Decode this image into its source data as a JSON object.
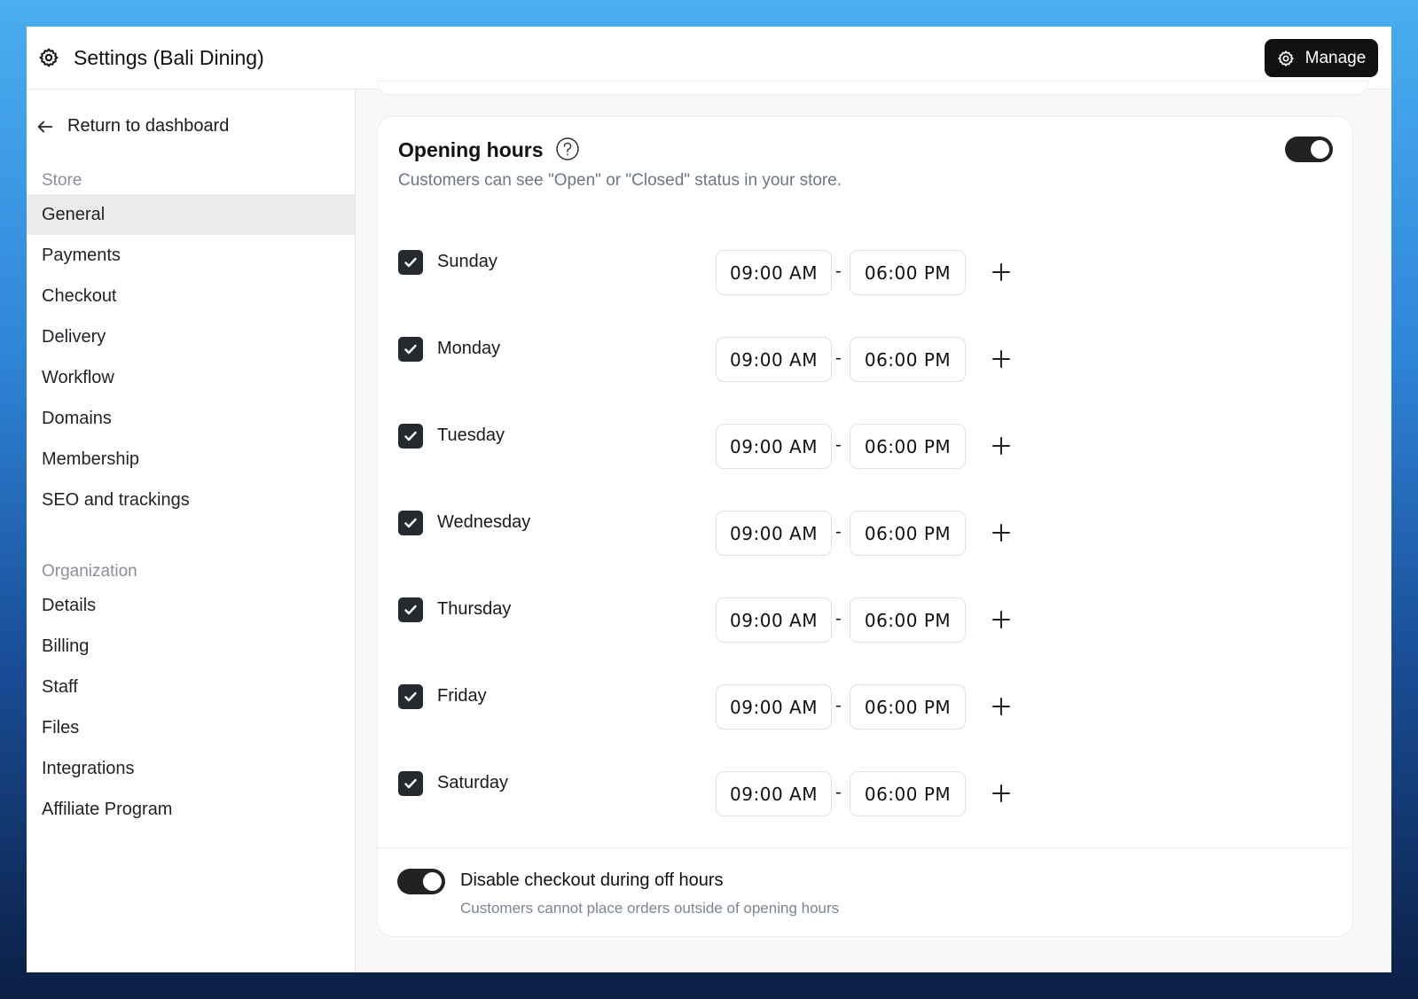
{
  "header": {
    "title": "Settings (Bali Dining)",
    "manage_label": "Manage"
  },
  "sidebar": {
    "back_label": "Return to dashboard",
    "store_section": "Store",
    "store_items": [
      "General",
      "Payments",
      "Checkout",
      "Delivery",
      "Workflow",
      "Domains",
      "Membership",
      "SEO and trackings"
    ],
    "active_item": "General",
    "org_section": "Organization",
    "org_items": [
      "Details",
      "Billing",
      "Staff",
      "Files",
      "Integrations",
      "Affiliate Program"
    ]
  },
  "opening_hours": {
    "title": "Opening hours",
    "description": "Customers can see \"Open\" or \"Closed\" status in your store.",
    "enabled": true,
    "days": [
      {
        "day": "Sunday",
        "checked": true,
        "start": "09:00 AM",
        "end": "06:00 PM"
      },
      {
        "day": "Monday",
        "checked": true,
        "start": "09:00 AM",
        "end": "06:00 PM"
      },
      {
        "day": "Tuesday",
        "checked": true,
        "start": "09:00 AM",
        "end": "06:00 PM"
      },
      {
        "day": "Wednesday",
        "checked": true,
        "start": "09:00 AM",
        "end": "06:00 PM"
      },
      {
        "day": "Thursday",
        "checked": true,
        "start": "09:00 AM",
        "end": "06:00 PM"
      },
      {
        "day": "Friday",
        "checked": true,
        "start": "09:00 AM",
        "end": "06:00 PM"
      },
      {
        "day": "Saturday",
        "checked": true,
        "start": "09:00 AM",
        "end": "06:00 PM"
      }
    ],
    "separator": "-",
    "disable_checkout": {
      "label": "Disable checkout during off hours",
      "description": "Customers cannot place orders outside of opening hours",
      "enabled": true
    }
  },
  "icons": {
    "settings": "gear-icon",
    "back": "arrow-left-icon",
    "help": "question-circle-icon",
    "check": "check-icon",
    "add": "plus-icon"
  },
  "colors": {
    "accent": "#111111",
    "active_nav_bg": "#ebebeb",
    "muted_text": "#6b7785"
  }
}
